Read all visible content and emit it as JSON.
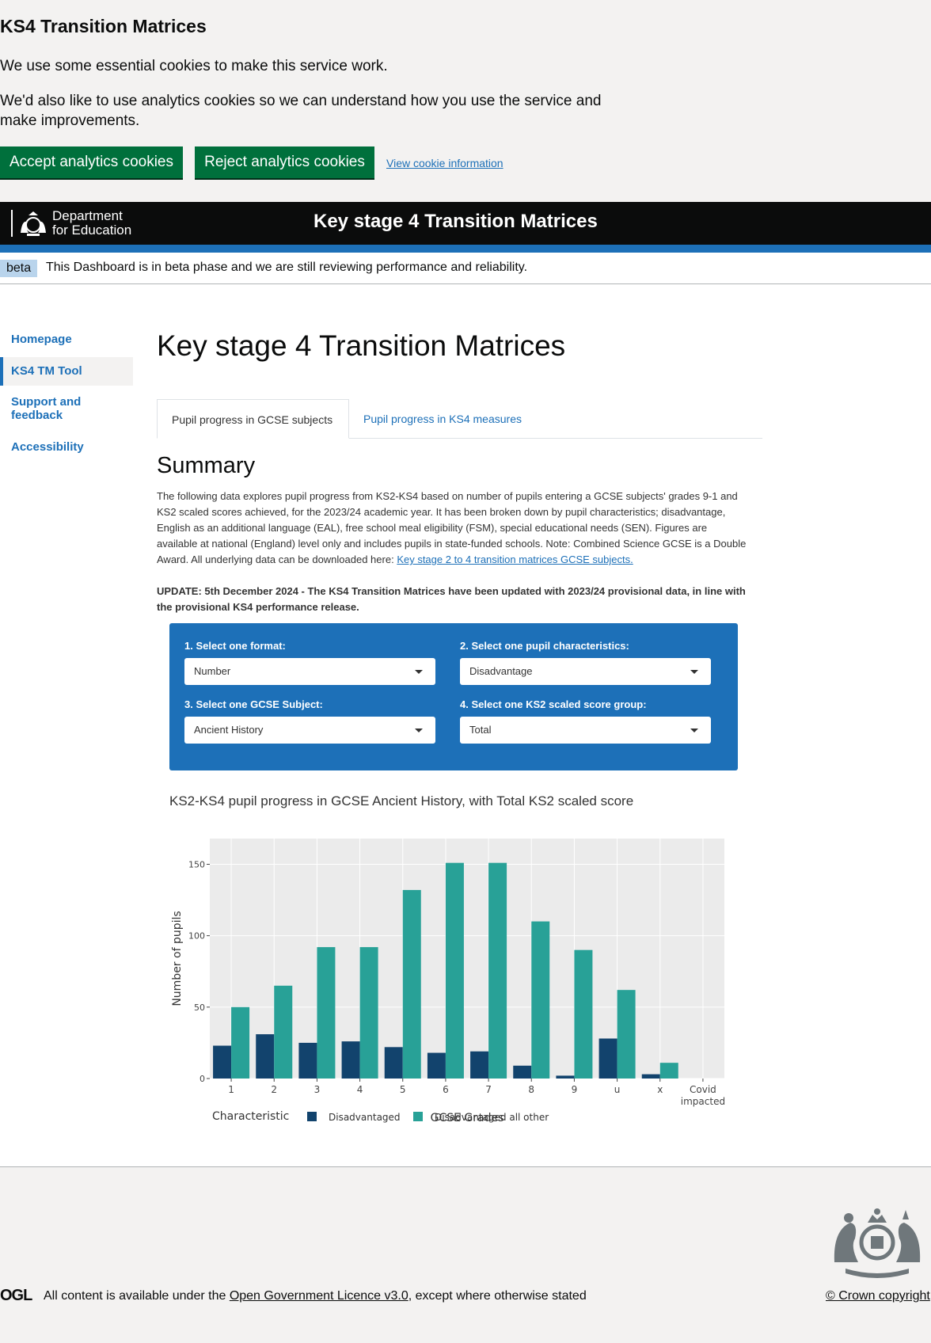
{
  "cookie": {
    "title": "KS4 Transition Matrices",
    "p1": "We use some essential cookies to make this service work.",
    "p2": "We'd also like to use analytics cookies so we can understand how you use the service and make improvements.",
    "accept": "Accept analytics cookies",
    "reject": "Reject analytics cookies",
    "view": "View cookie information"
  },
  "header": {
    "dept_line1": "Department",
    "dept_line2": "for Education",
    "title": "Key stage 4 Transition Matrices"
  },
  "beta": {
    "tag": "beta",
    "text": "This Dashboard is in beta phase and we are still reviewing performance and reliability."
  },
  "sidebar": {
    "items": [
      {
        "label": "Homepage"
      },
      {
        "label": "KS4 TM Tool"
      },
      {
        "label": "Support and feedback"
      },
      {
        "label": "Accessibility"
      }
    ]
  },
  "main": {
    "title": "Key stage 4 Transition Matrices",
    "tabs": [
      {
        "label": "Pupil progress in GCSE subjects"
      },
      {
        "label": "Pupil progress in KS4 measures"
      }
    ],
    "summary_heading": "Summary",
    "summary_text": "The following data explores pupil progress from KS2-KS4 based on number of pupils entering a GCSE subjects' grades 9-1 and KS2 scaled scores achieved, for the 2023/24 academic year. It has been broken down by pupil characteristics; disadvantage, English as an additional language (EAL), free school meal eligibility (FSM), special educational needs (SEN). Figures are available at national (England) level only and includes pupils in state-funded schools. Note: Combined Science GCSE is a Double Award. All underlying data can be downloaded here: ",
    "summary_link": "Key stage 2 to 4 transition matrices GCSE subjects.",
    "update": "UPDATE: 5th December 2024 - The KS4 Transition Matrices have been updated with 2023/24 provisional data, in line with the provisional KS4 performance release."
  },
  "filters": {
    "format_label": "1. Select one format:",
    "format_value": "Number",
    "characteristic_label": "2. Select one pupil characteristics:",
    "characteristic_value": "Disadvantage",
    "subject_label": "3. Select one GCSE Subject:",
    "subject_value": "Ancient History",
    "ks2_label": "4. Select one KS2 scaled score group:",
    "ks2_value": "Total"
  },
  "chart_title": "KS2-KS4 pupil progress in GCSE Ancient History, with Total KS2 scaled score",
  "chart_data": {
    "type": "bar",
    "categories": [
      "1",
      "2",
      "3",
      "4",
      "5",
      "6",
      "7",
      "8",
      "9",
      "u",
      "x",
      "Covid impacted"
    ],
    "series": [
      {
        "name": "Disadvantaged",
        "color": "#12436d",
        "values": [
          23,
          31,
          25,
          26,
          22,
          18,
          19,
          9,
          2,
          28,
          3,
          0
        ]
      },
      {
        "name": "Disadvantaged all other",
        "color": "#28a197",
        "values": [
          50,
          65,
          92,
          92,
          132,
          151,
          151,
          110,
          90,
          62,
          11,
          0
        ]
      }
    ],
    "xlabel": "GCSE Grades",
    "ylabel": "Number of pupils",
    "ylim": [
      0,
      168
    ],
    "yticks": [
      0,
      50,
      100,
      150
    ],
    "legend_title": "Characteristic",
    "legend_position": "bottom",
    "grid": true
  },
  "footer": {
    "ogl": "OGL",
    "licence_prefix": "All content is available under the ",
    "licence_link": "Open Government Licence v3.0",
    "licence_suffix": ", except where otherwise stated",
    "copyright": "© Crown copyright"
  }
}
